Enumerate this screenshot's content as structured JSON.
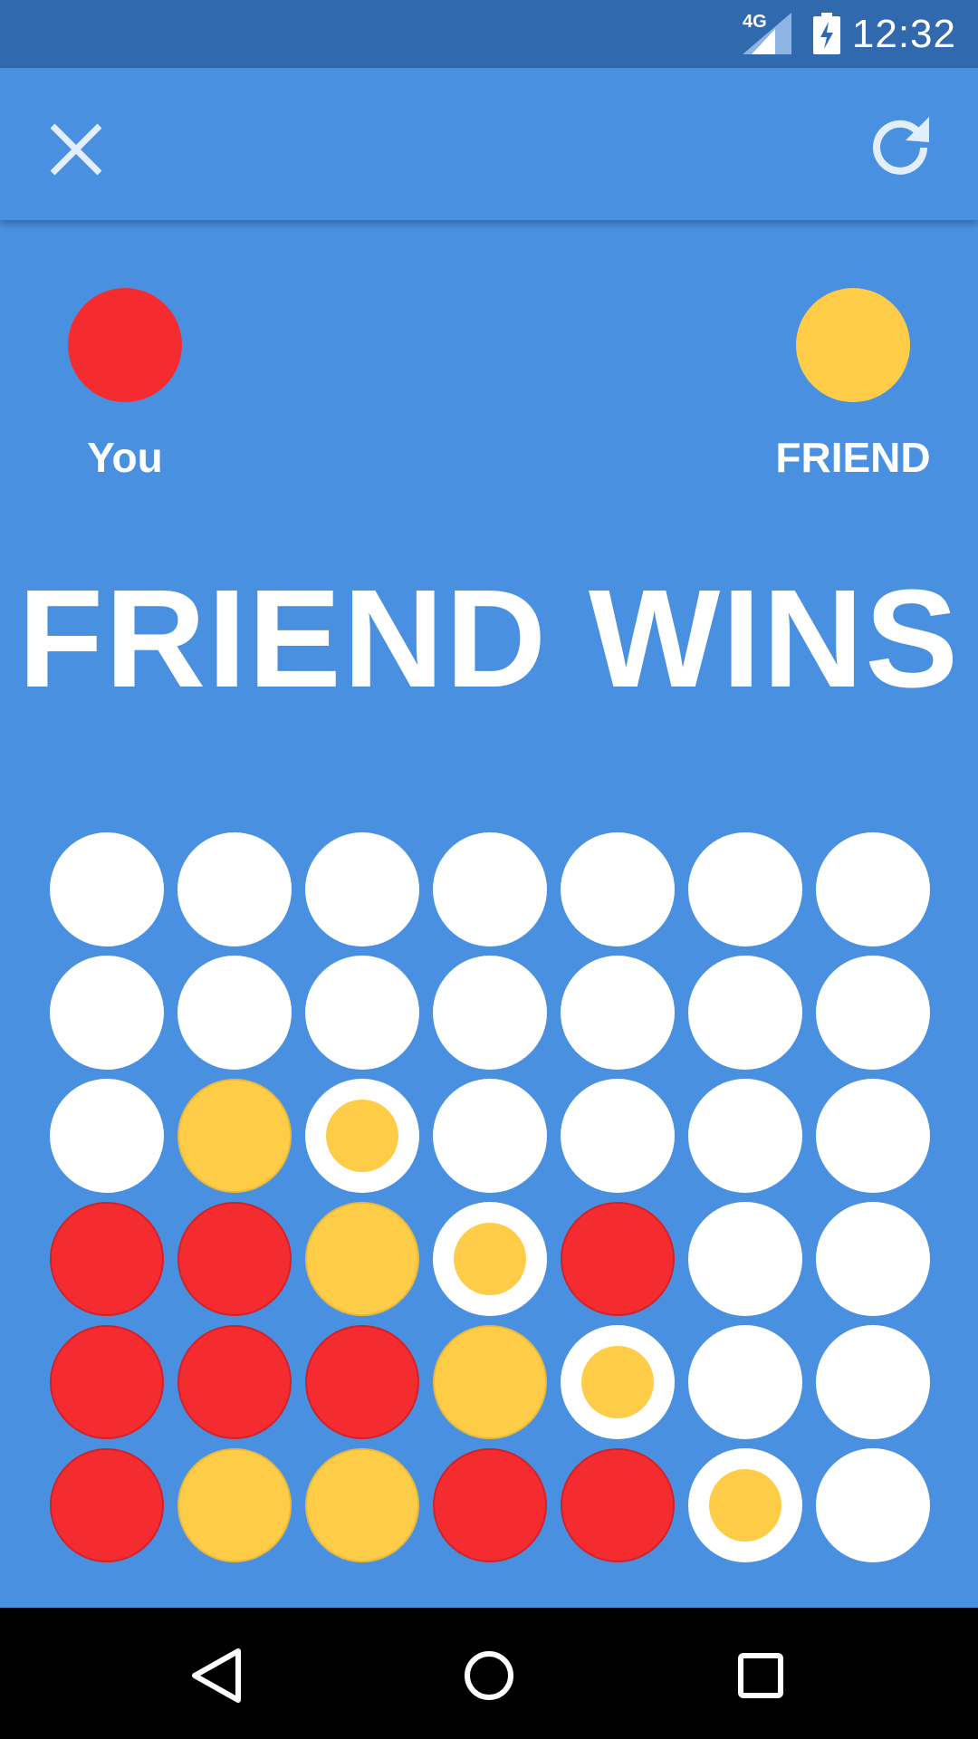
{
  "status_bar": {
    "time": "12:32",
    "network": "4G",
    "icons": [
      "signal-icon",
      "battery-charging-icon"
    ]
  },
  "toolbar": {
    "close_icon": "close-icon",
    "restart_icon": "refresh-icon"
  },
  "players": {
    "you": {
      "label": "You",
      "color": "#f52c2f"
    },
    "friend": {
      "label": "FRIEND",
      "color": "#ffcc47"
    }
  },
  "result": "FRIEND WINS",
  "board": {
    "columns": 7,
    "rows": 6,
    "legend": {
      "E": "empty",
      "R": "red",
      "Y": "yellow",
      "W": "yellow-winning"
    },
    "cells": [
      [
        "E",
        "E",
        "E",
        "E",
        "E",
        "E",
        "E"
      ],
      [
        "E",
        "E",
        "E",
        "E",
        "E",
        "E",
        "E"
      ],
      [
        "E",
        "Y",
        "W",
        "E",
        "E",
        "E",
        "E"
      ],
      [
        "R",
        "R",
        "Y",
        "W",
        "R",
        "E",
        "E"
      ],
      [
        "R",
        "R",
        "R",
        "Y",
        "W",
        "E",
        "E"
      ],
      [
        "R",
        "Y",
        "Y",
        "R",
        "R",
        "W",
        "E"
      ]
    ]
  },
  "navigation": {
    "buttons": [
      "back-icon",
      "home-icon",
      "recents-icon"
    ]
  },
  "colors": {
    "background": "#4a90e0",
    "status_bar": "#3169af",
    "red": "#f52c2f",
    "yellow": "#ffcc47",
    "empty": "#ffffff"
  }
}
